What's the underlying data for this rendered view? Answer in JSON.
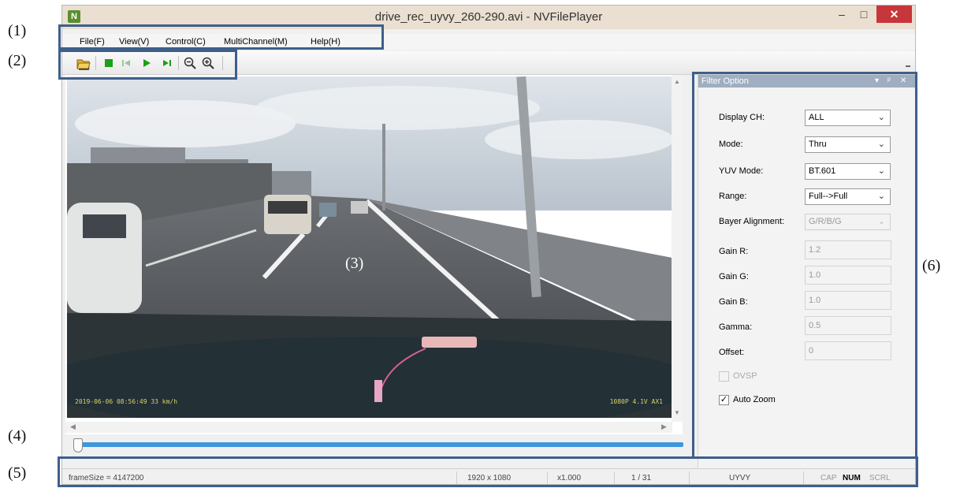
{
  "callouts": [
    "(1)",
    "(2)",
    "(3)",
    "(4)",
    "(5)",
    "(6)"
  ],
  "window": {
    "title": "drive_rec_uyvy_260-290.avi - NVFilePlayer",
    "app_icon": "N"
  },
  "window_buttons": {
    "minimize": "–",
    "maximize": "□",
    "close": "✕"
  },
  "menu": {
    "file": "File(F)",
    "view": "View(V)",
    "control": "Control(C)",
    "multichannel": "MultiChannel(M)",
    "help": "Help(H)"
  },
  "toolbar": {
    "icons": [
      "open-folder-icon",
      "stop-icon",
      "step-back-icon",
      "play-icon",
      "step-forward-icon",
      "zoom-out-icon",
      "zoom-in-icon"
    ]
  },
  "video": {
    "osd_left": "2019-06-06 08:56:49  33 km/h",
    "osd_right": "1080P  4.1V AX1"
  },
  "seek": {
    "position_fraction": 0.0
  },
  "status": {
    "frame_size": "frameSize = 4147200",
    "resolution": "1920 x 1080",
    "zoom": "x1.000",
    "frame": "1 / 31",
    "format": "UYVY",
    "cap": "CAP",
    "num": "NUM",
    "scrl": "SCRL"
  },
  "filter_panel": {
    "title": "Filter Option",
    "buttons": {
      "dropdown": "▾",
      "pin": "ᵖ",
      "close": "✕"
    },
    "display_ch": {
      "label": "Display CH:",
      "value": "ALL"
    },
    "mode": {
      "label": "Mode:",
      "value": "Thru"
    },
    "yuv_mode": {
      "label": "YUV Mode:",
      "value": "BT.601"
    },
    "range": {
      "label": "Range:",
      "value": "Full-->Full"
    },
    "bayer_alignment": {
      "label": "Bayer Alignment:",
      "value": "G/R/B/G"
    },
    "gain_r": {
      "label": "Gain R:",
      "value": "1.2"
    },
    "gain_g": {
      "label": "Gain G:",
      "value": "1.0"
    },
    "gain_b": {
      "label": "Gain B:",
      "value": "1.0"
    },
    "gamma": {
      "label": "Gamma:",
      "value": "0.5"
    },
    "offset": {
      "label": "Offset:",
      "value": "0"
    },
    "ovsp": {
      "label": "OVSP",
      "checked": false,
      "enabled": false
    },
    "auto_zoom": {
      "label": "Auto Zoom",
      "checked": true,
      "enabled": true
    }
  },
  "colors": {
    "callout_box": "#3e5f8a",
    "title_bar": "#eadfd0",
    "close_button": "#c7363a",
    "panel_header": "#9faec1",
    "seek_track": "#3f97dd"
  }
}
